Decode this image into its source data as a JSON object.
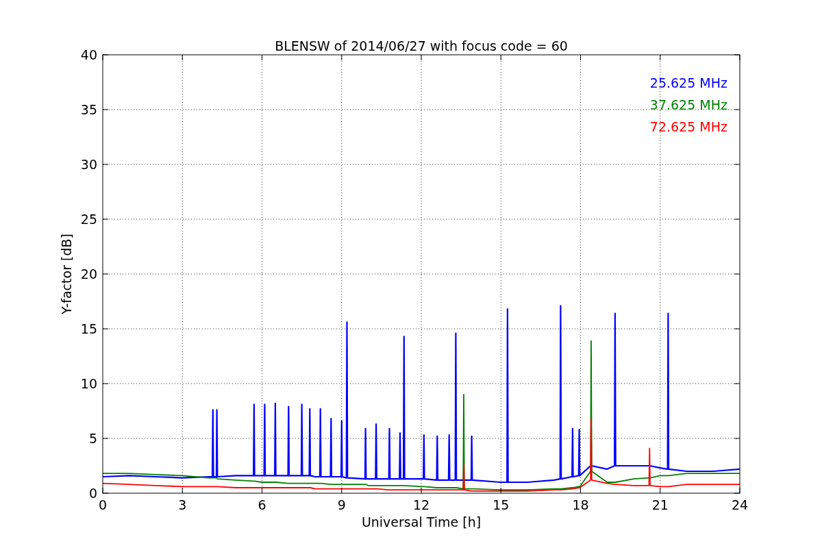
{
  "chart_data": {
    "type": "line",
    "grid": true,
    "title": "BLENSW of 2014/06/27 with focus code = 60",
    "xlabel": "Universal Time [h]",
    "ylabel": "Y-factor [dB]",
    "xlim": [
      0,
      24
    ],
    "ylim": [
      0,
      40
    ],
    "xticks": [
      0,
      3,
      6,
      9,
      12,
      15,
      18,
      21,
      24
    ],
    "yticks": [
      0,
      5,
      10,
      15,
      20,
      25,
      30,
      35,
      40
    ],
    "x": [
      0,
      1,
      2,
      3,
      4,
      4.13,
      4.15,
      4.17,
      4.28,
      4.3,
      4.32,
      5,
      5.68,
      5.7,
      5.72,
      6,
      6.08,
      6.1,
      6.12,
      6.48,
      6.5,
      6.52,
      6.98,
      7,
      7.02,
      7.48,
      7.5,
      7.52,
      7.78,
      7.8,
      7.82,
      8,
      8.18,
      8.2,
      8.22,
      8.58,
      8.6,
      8.62,
      8.98,
      9,
      9.02,
      9.18,
      9.2,
      9.22,
      9.88,
      9.9,
      9.92,
      10,
      10.28,
      10.3,
      10.32,
      10.78,
      10.8,
      10.82,
      11.18,
      11.2,
      11.22,
      11.33,
      11.35,
      11.37,
      12,
      12.08,
      12.1,
      12.12,
      12.58,
      12.6,
      12.62,
      13.03,
      13.05,
      13.07,
      13.28,
      13.3,
      13.32,
      13.58,
      13.6,
      13.62,
      13.88,
      13.9,
      13.92,
      15,
      15.23,
      15.25,
      15.27,
      16,
      17,
      17.23,
      17.25,
      17.27,
      17.68,
      17.7,
      17.72,
      17.93,
      17.95,
      17.97,
      18.38,
      18.4,
      18.42,
      19,
      19.28,
      19.3,
      19.32,
      20,
      20.58,
      20.6,
      20.62,
      21,
      21.28,
      21.3,
      21.32,
      22,
      23,
      24
    ],
    "series": [
      {
        "name": "25.625 MHz",
        "color": "#0000ff",
        "values": [
          1.5,
          1.6,
          1.5,
          1.4,
          1.5,
          1.5,
          7.6,
          1.5,
          1.5,
          7.6,
          1.5,
          1.6,
          1.6,
          8.1,
          1.6,
          1.6,
          1.6,
          8.1,
          1.6,
          1.6,
          8.2,
          1.6,
          1.6,
          7.9,
          1.6,
          1.6,
          8.1,
          1.6,
          1.6,
          7.7,
          1.6,
          1.5,
          1.5,
          7.7,
          1.5,
          1.5,
          6.8,
          1.5,
          1.5,
          6.6,
          1.5,
          1.4,
          15.6,
          1.4,
          1.3,
          5.9,
          1.3,
          1.3,
          1.3,
          6.3,
          1.3,
          1.3,
          5.9,
          1.3,
          1.3,
          5.5,
          1.3,
          1.3,
          14.3,
          1.3,
          1.3,
          1.3,
          5.3,
          1.3,
          1.2,
          5.2,
          1.2,
          1.2,
          5.3,
          1.2,
          1.2,
          14.6,
          1.2,
          1.2,
          null,
          1.2,
          1.2,
          5.2,
          1.2,
          1.0,
          1.0,
          16.8,
          1.0,
          1.0,
          1.2,
          1.3,
          17.1,
          1.3,
          1.5,
          5.9,
          1.5,
          1.6,
          5.8,
          1.6,
          2.5,
          null,
          2.5,
          2.2,
          2.5,
          16.4,
          2.5,
          2.5,
          2.5,
          null,
          2.5,
          2.3,
          2.2,
          16.4,
          2.2,
          2.0,
          2.0,
          2.2
        ]
      },
      {
        "name": "37.625 MHz",
        "color": "#008000",
        "values": [
          1.8,
          1.8,
          1.7,
          1.6,
          1.4,
          1.4,
          1.4,
          1.4,
          1.4,
          1.4,
          1.3,
          1.2,
          1.1,
          1.1,
          1.1,
          1.0,
          1.0,
          1.0,
          1.0,
          1.0,
          1.0,
          1.0,
          0.9,
          0.9,
          0.9,
          0.9,
          0.9,
          0.9,
          0.9,
          0.9,
          0.9,
          0.9,
          0.9,
          0.9,
          0.9,
          0.8,
          0.8,
          0.8,
          0.8,
          0.8,
          0.8,
          0.8,
          0.8,
          0.8,
          0.8,
          0.8,
          0.8,
          0.7,
          0.7,
          0.7,
          0.7,
          0.7,
          0.7,
          0.7,
          0.7,
          0.7,
          0.7,
          0.7,
          0.7,
          0.7,
          0.6,
          0.6,
          0.6,
          0.6,
          0.5,
          0.5,
          0.5,
          0.5,
          0.5,
          0.5,
          0.5,
          0.5,
          0.5,
          0.4,
          9.0,
          0.4,
          0.4,
          0.4,
          0.4,
          0.3,
          0.3,
          0.3,
          0.3,
          0.3,
          0.4,
          0.4,
          0.4,
          0.4,
          0.5,
          0.5,
          0.5,
          0.6,
          0.6,
          0.6,
          2.0,
          13.9,
          2.0,
          1.0,
          1.0,
          1.0,
          1.0,
          1.3,
          1.4,
          1.4,
          1.4,
          1.6,
          1.6,
          1.6,
          1.6,
          1.8,
          1.8,
          1.8
        ]
      },
      {
        "name": "72.625 MHz",
        "color": "#ff0000",
        "values": [
          0.9,
          0.8,
          0.7,
          0.6,
          0.6,
          0.6,
          0.6,
          0.6,
          0.6,
          0.6,
          0.6,
          0.5,
          0.5,
          0.5,
          0.5,
          0.5,
          0.5,
          0.5,
          0.5,
          0.5,
          0.5,
          0.5,
          0.5,
          0.5,
          0.5,
          0.5,
          0.5,
          0.5,
          0.5,
          0.5,
          0.5,
          0.4,
          0.4,
          0.4,
          0.4,
          0.4,
          0.4,
          0.4,
          0.4,
          0.4,
          0.4,
          0.4,
          0.4,
          0.4,
          0.4,
          0.4,
          0.4,
          0.4,
          0.4,
          0.4,
          0.4,
          0.3,
          0.3,
          0.3,
          0.3,
          0.3,
          0.3,
          0.3,
          0.3,
          0.3,
          0.3,
          0.3,
          0.3,
          0.3,
          0.3,
          0.3,
          0.3,
          0.3,
          0.3,
          0.3,
          0.3,
          0.3,
          0.3,
          0.3,
          2.6,
          0.3,
          0.2,
          0.2,
          0.2,
          0.2,
          0.2,
          0.2,
          0.2,
          0.2,
          0.3,
          0.3,
          0.3,
          0.3,
          0.4,
          0.4,
          0.4,
          0.5,
          0.5,
          0.5,
          1.2,
          6.8,
          1.2,
          0.9,
          0.8,
          0.8,
          0.8,
          0.7,
          0.7,
          4.1,
          0.7,
          0.6,
          0.6,
          0.6,
          0.6,
          0.8,
          0.8,
          0.8
        ]
      }
    ]
  }
}
